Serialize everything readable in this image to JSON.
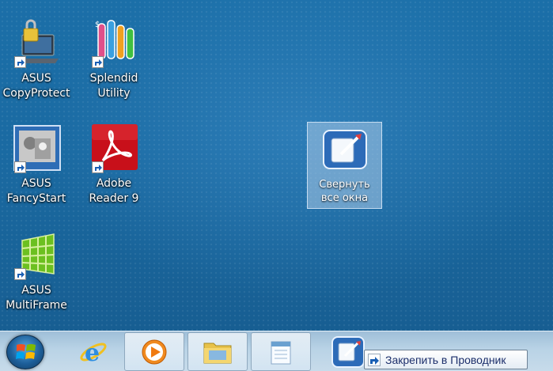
{
  "desktop": {
    "icons": [
      {
        "label_line1": "ASUS",
        "label_line2": "CopyProtect",
        "icon": "laptop-lock-icon"
      },
      {
        "label_line1": "Splendid",
        "label_line2": "Utility",
        "icon": "test-tubes-icon"
      },
      {
        "label_line1": "ASUS",
        "label_line2": "FancyStart",
        "icon": "photo-icon"
      },
      {
        "label_line1": "Adobe",
        "label_line2": "Reader 9",
        "icon": "adobe-reader-icon"
      },
      {
        "label_line1": "ASUS",
        "label_line2": "MultiFrame",
        "icon": "multiframe-grid-icon"
      }
    ],
    "selected_icon": {
      "label_line1": "Свернуть",
      "label_line2": "все окна",
      "icon": "show-desktop-icon"
    }
  },
  "taskbar": {
    "start": "windows-start-orb",
    "items": [
      {
        "name": "internet-explorer",
        "icon": "ie-icon"
      },
      {
        "name": "media-player",
        "icon": "media-player-icon"
      },
      {
        "name": "explorer",
        "icon": "folder-icon"
      },
      {
        "name": "notepad",
        "icon": "notepad-icon"
      },
      {
        "name": "show-desktop",
        "icon": "show-desktop-icon"
      }
    ]
  },
  "tooltip": {
    "text": "Закрепить в Проводник",
    "icon": "shortcut-arrow-icon"
  },
  "colors": {
    "desktop": "#1b6fa8",
    "taskbar": "#b9d3e6",
    "tooltip_text": "#1c2f6b"
  }
}
